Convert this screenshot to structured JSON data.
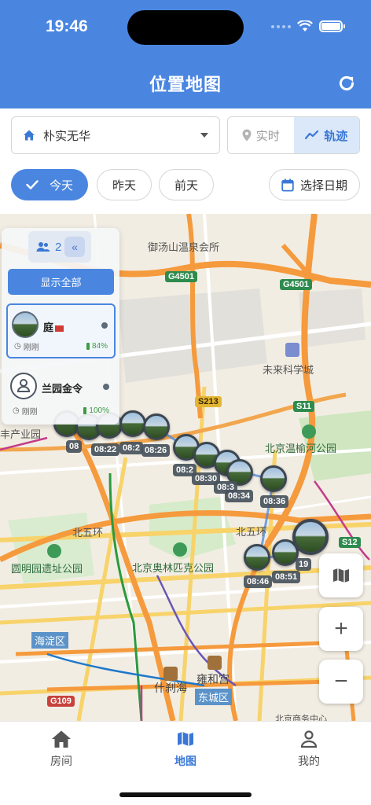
{
  "status_bar": {
    "time": "19:46"
  },
  "header": {
    "title": "位置地图",
    "refresh_icon": "refresh-icon"
  },
  "controls": {
    "selector_value": "朴实无华",
    "mode": {
      "realtime": "实时",
      "track": "轨迹",
      "selected": "轨迹"
    },
    "date_chips": {
      "today": "今天",
      "yesterday": "昨天",
      "day_before": "前天",
      "pick_date": "选择日期",
      "selected": "今天"
    }
  },
  "panel": {
    "device_count": "2",
    "show_all": "显示全部",
    "devices": [
      {
        "name": "庭",
        "time": "刚刚",
        "battery": "84%",
        "active": true
      },
      {
        "name": "兰园金令",
        "time": "刚刚",
        "battery": "100%",
        "active": false
      }
    ]
  },
  "map": {
    "places": {
      "hot_spring": "御汤山温泉会所",
      "future_city": "未来科学城",
      "wenyu_park": "北京温榆河公园",
      "yuanmingyuan": "圆明园遗址公园",
      "olympic_park": "北京奥林匹克公园",
      "north_5th_ring_left": "北五环",
      "north_5th_ring_right": "北五环",
      "shichahai": "什刹海",
      "yonghegong": "雍和宫",
      "cbd": "北京商务中心",
      "industry_park": "丰产业园"
    },
    "districts": {
      "haidian": "海淀区",
      "dongcheng": "东城区"
    },
    "shields": {
      "g4501_top": "G4501",
      "g4501_right": "G4501",
      "s213": "S213",
      "s11": "S11",
      "s12": "S12",
      "g109": "G109"
    },
    "track_times": [
      "08",
      "08:22",
      "08:2",
      "08:26",
      "08:2",
      "08:30",
      "08:3",
      "08:34",
      "08:36",
      "08:46",
      "08:51",
      "19"
    ],
    "buttons": {
      "layers_icon": "map-icon",
      "zoom_in": "+",
      "zoom_out": "−"
    }
  },
  "tabbar": {
    "items": [
      {
        "label": "房间",
        "icon": "home-icon"
      },
      {
        "label": "地图",
        "icon": "map-icon"
      },
      {
        "label": "我的",
        "icon": "user-icon"
      }
    ],
    "active": "地图"
  },
  "colors": {
    "primary": "#4a86e0",
    "highway": "#f59a3d",
    "park": "#3d9a57"
  }
}
